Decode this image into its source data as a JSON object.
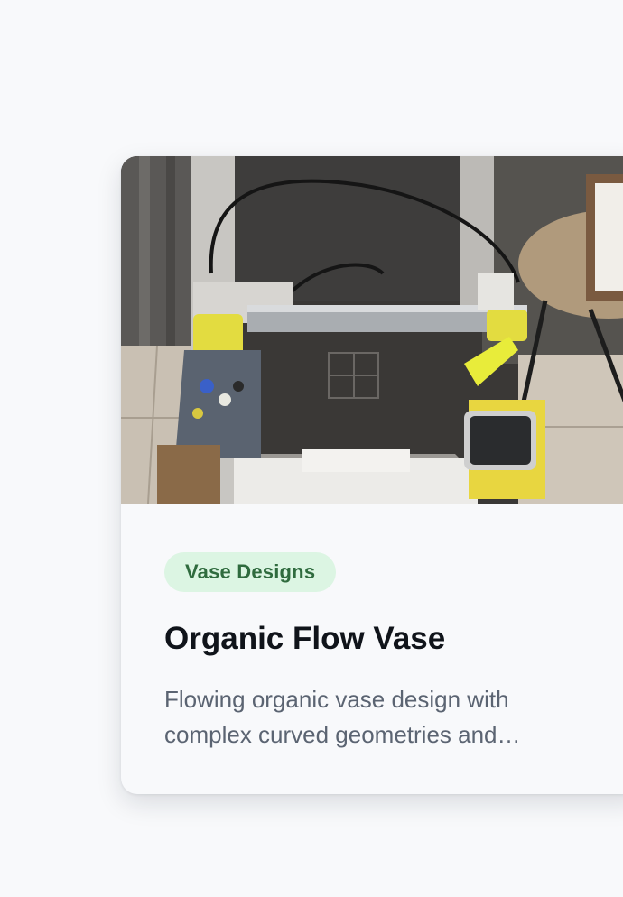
{
  "card": {
    "image_subject": "3d-printer-photo",
    "category_tag": "Vase Designs",
    "title": "Organic Flow Vase",
    "description": "Flowing organic vase design with complex curved geometries and…"
  },
  "colors": {
    "background": "#f8f9fb",
    "tag_background": "#dcf5e3",
    "tag_text": "#2f6b3e",
    "title_text": "#10141a",
    "description_text": "#5b6472"
  }
}
